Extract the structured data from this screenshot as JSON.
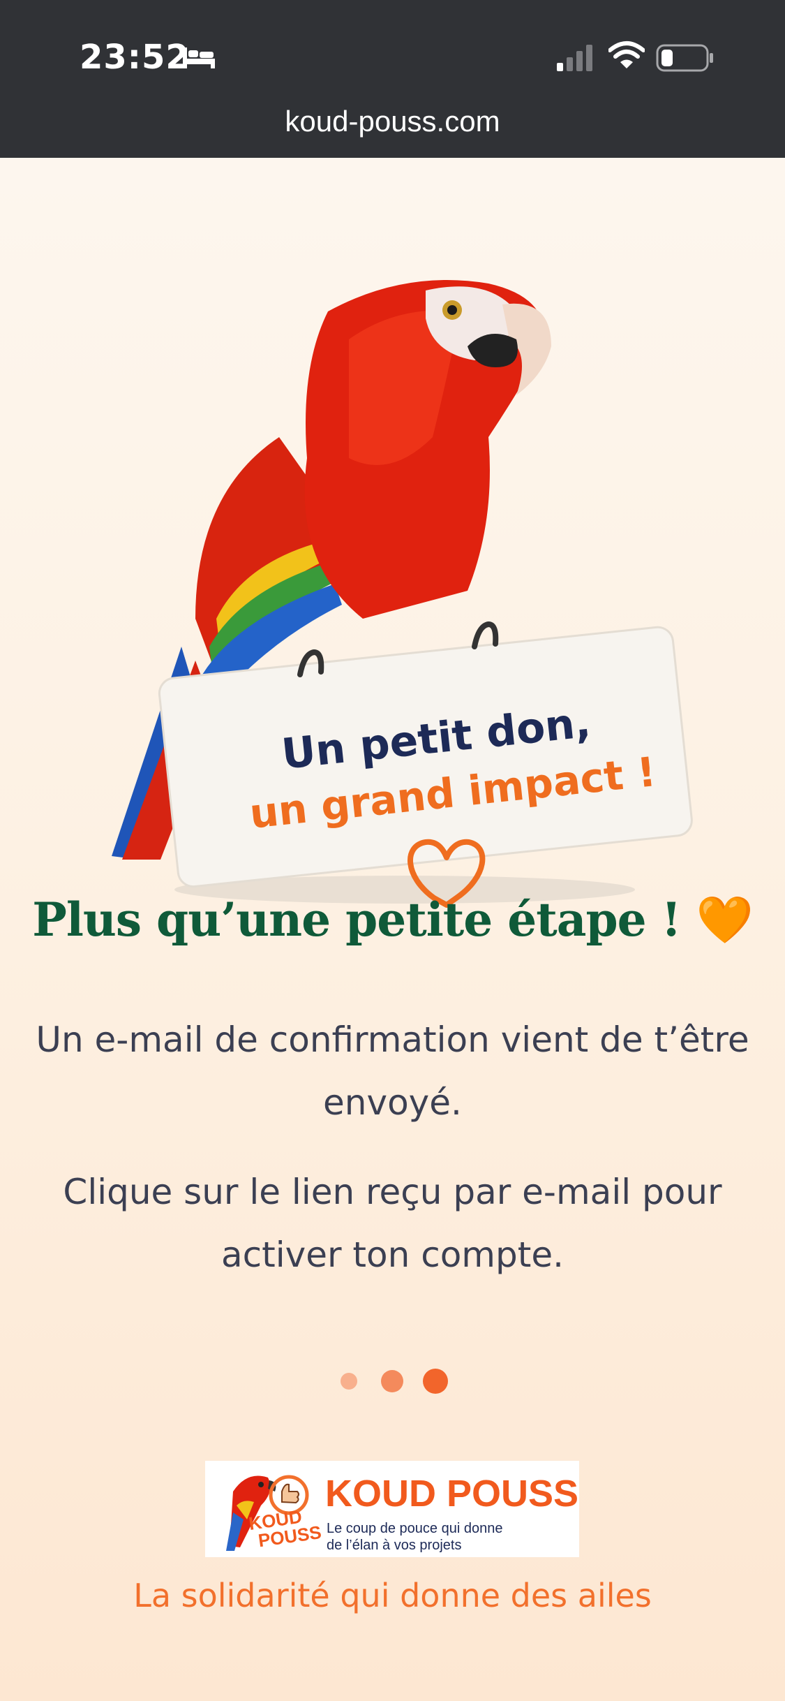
{
  "status_bar": {
    "time": "23:52",
    "icons": [
      "bed-icon",
      "cellular-signal-icon",
      "wifi-icon",
      "battery-icon"
    ],
    "url": "koud-pouss.com"
  },
  "hero": {
    "sign_line1": "Un petit don,",
    "sign_line2": "un grand impact !",
    "icons": [
      "parrot-illustration",
      "heart-outline-icon"
    ]
  },
  "main": {
    "heading": "Plus qu’une petite étape !",
    "heading_emoji": "🧡",
    "paragraph1": "Un e-mail de confirmation vient de t’être envoyé.",
    "paragraph2": "Clique sur le lien reçu par e-mail pour activer ton compte."
  },
  "pagination": {
    "total": 3,
    "active_index": 2
  },
  "footer": {
    "logo_title": "KOUD POUSS",
    "logo_mini_line1": "KOUD",
    "logo_mini_line2": "POUSS",
    "logo_tag_line1": "Le coup de pouce qui donne",
    "logo_tag_line2": "de l’élan à vos projets",
    "tagline": "La solidarité qui donne des ailes"
  },
  "colors": {
    "status_bar_bg": "#303236",
    "heading_green": "#0f5a39",
    "accent_orange": "#f2702c",
    "text_dark": "#3b3f52"
  }
}
